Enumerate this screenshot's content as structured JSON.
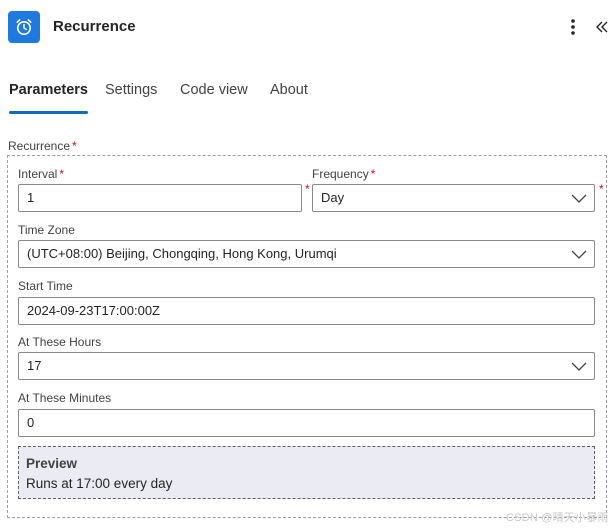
{
  "header": {
    "title": "Recurrence",
    "app_icon": "alarm-clock-icon",
    "more_icon": "more-vertical-icon",
    "collapse_icon": "double-chevron-left-icon",
    "accent_color": "#1f7ae0"
  },
  "tabs": [
    {
      "label": "Parameters",
      "active": true
    },
    {
      "label": "Settings",
      "active": false
    },
    {
      "label": "Code view",
      "active": false
    },
    {
      "label": "About",
      "active": false
    }
  ],
  "recurrence": {
    "label": "Recurrence",
    "required_mark": "*",
    "interval": {
      "label": "Interval",
      "required_mark": "*",
      "value": "1"
    },
    "frequency": {
      "label": "Frequency",
      "required_mark": "*",
      "value": "Day"
    },
    "time_zone": {
      "label": "Time Zone",
      "value": "(UTC+08:00) Beijing, Chongqing, Hong Kong, Urumqi"
    },
    "start_time": {
      "label": "Start Time",
      "value": "2024-09-23T17:00:00Z"
    },
    "at_these_hours": {
      "label": "At These Hours",
      "value": "17"
    },
    "at_these_minutes": {
      "label": "At These Minutes",
      "value": "0"
    },
    "preview": {
      "title": "Preview",
      "text": "Runs at 17:00 every day"
    }
  },
  "watermark": "CSDN @晴天小暴雨",
  "colors": {
    "tab_underline": "#0f6cbd",
    "required": "#c50f1f",
    "preview_bg": "#ebecf3"
  }
}
